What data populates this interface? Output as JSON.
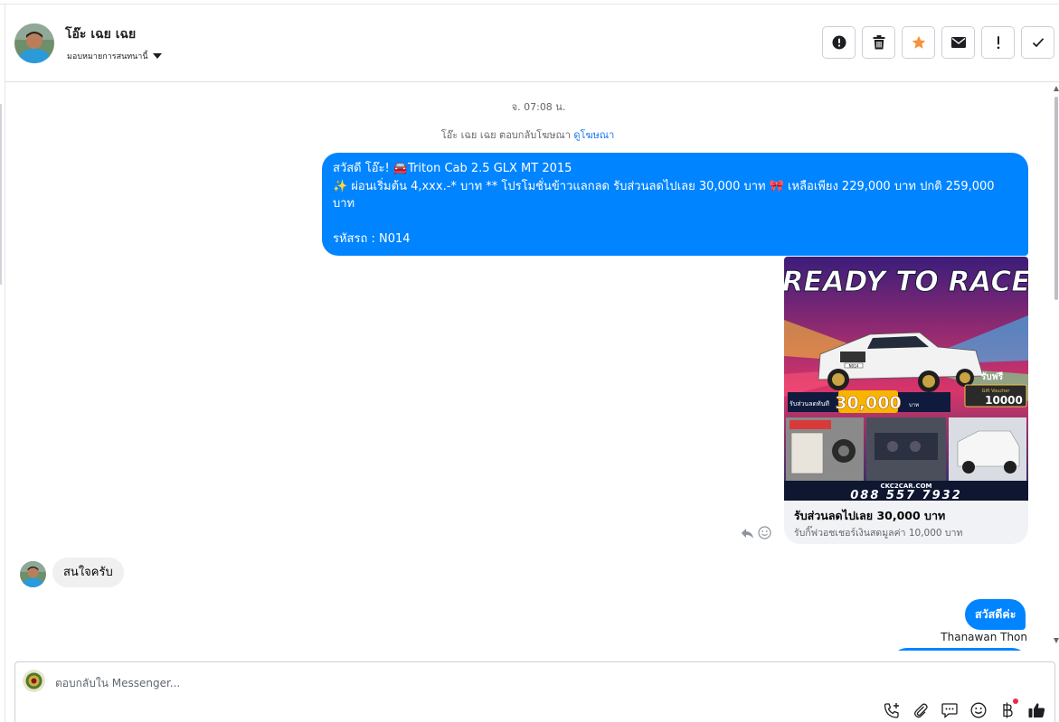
{
  "header": {
    "contact_name": "โอ๊ะ เฉย เฉย",
    "assign_label": "มอบหมายการสนทนานี้",
    "toolbar": [
      {
        "name": "spam-button",
        "icon": "alert-circle-icon"
      },
      {
        "name": "delete-button",
        "icon": "trash-icon"
      },
      {
        "name": "star-button",
        "icon": "star-icon"
      },
      {
        "name": "mark-unread-button",
        "icon": "envelope-icon"
      },
      {
        "name": "follow-up-button",
        "icon": "exclamation-icon"
      },
      {
        "name": "mark-done-button",
        "icon": "check-icon"
      }
    ]
  },
  "conversation": {
    "timestamp": "จ. 07:08 น.",
    "reply_note": "โอ๊ะ เฉย เฉย ตอบกลับโฆษณา",
    "reply_note_link": "ดูโฆษณา",
    "ad_message": "สวัสดี โอ๊ะ! 🚘Triton Cab 2.5 GLX MT 2015\n✨ ผ่อนเริ่มต้น 4,xxx.-* บาท ** โปรโมชั่นข้าวแลกลด รับส่วนลดไปเลย 30,000 บาท 🎀 เหลือเพียง 229,000 บาท ปกติ 259,000 บาท\n\nรหัสรถ : N014",
    "card": {
      "headline": "READY TO RACE",
      "plate": "N014",
      "discount_label": "รับส่วนลดทันที",
      "discount_value": "30,000",
      "discount_unit": "บาท",
      "gift_label": "รับฟรี",
      "gift_voucher": "Gift Voucher",
      "gift_value": "10000",
      "website": "CKC2CAR.COM",
      "phone": "088 557 7932",
      "title": "รับส่วนลดไปเลย 30,000 บาท",
      "subtitle": "รับกิ๊ฟวอชเชอร์เงินสดมูลค่า 10,000 บาท"
    },
    "incoming_message": "สนใจครับ",
    "reply_message": "สวัสดีค่ะ",
    "reply_sender": "Thanawan Thon"
  },
  "composer": {
    "placeholder": "ตอบกลับใน Messenger...",
    "icons": [
      "add-call-icon",
      "attachment-icon",
      "saved-replies-icon",
      "emoji-icon",
      "payment-icon",
      "like-icon"
    ]
  },
  "colors": {
    "outgoing_bubble": "#0084ff",
    "incoming_bubble": "#f0f0f0",
    "star": "#f7923b",
    "link": "#1877f2",
    "notification_dot": "#f02849"
  }
}
